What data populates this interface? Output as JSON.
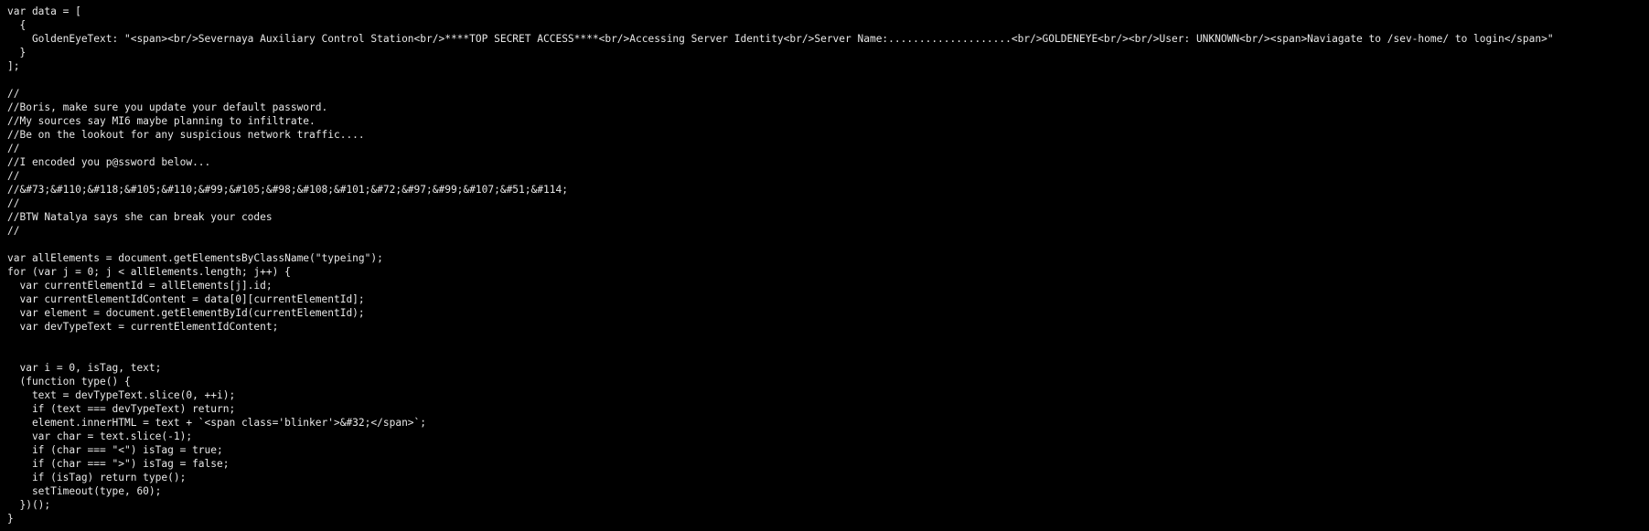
{
  "source_view": {
    "lines": [
      "var data = [",
      "  {",
      "    GoldenEyeText: \"<span><br/>Severnaya Auxiliary Control Station<br/>****TOP SECRET ACCESS****<br/>Accessing Server Identity<br/>Server Name:....................<br/>GOLDENEYE<br/><br/>User: UNKNOWN<br/><span>Naviagate to /sev-home/ to login</span>\"",
      "  }",
      "];",
      "",
      "//",
      "//Boris, make sure you update your default password.",
      "//My sources say MI6 maybe planning to infiltrate.",
      "//Be on the lookout for any suspicious network traffic....",
      "//",
      "//I encoded you p@ssword below...",
      "//",
      "//&#73;&#110;&#118;&#105;&#110;&#99;&#105;&#98;&#108;&#101;&#72;&#97;&#99;&#107;&#51;&#114;",
      "//",
      "//BTW Natalya says she can break your codes",
      "//",
      "",
      "var allElements = document.getElementsByClassName(\"typeing\");",
      "for (var j = 0; j < allElements.length; j++) {",
      "  var currentElementId = allElements[j].id;",
      "  var currentElementIdContent = data[0][currentElementId];",
      "  var element = document.getElementById(currentElementId);",
      "  var devTypeText = currentElementIdContent;",
      "",
      "",
      "  var i = 0, isTag, text;",
      "  (function type() {",
      "    text = devTypeText.slice(0, ++i);",
      "    if (text === devTypeText) return;",
      "    element.innerHTML = text + `<span class='blinker'>&#32;</span>`;",
      "    var char = text.slice(-1);",
      "    if (char === \"<\") isTag = true;",
      "    if (char === \">\") isTag = false;",
      "    if (isTag) return type();",
      "    setTimeout(type, 60);",
      "  })();",
      "}"
    ]
  }
}
